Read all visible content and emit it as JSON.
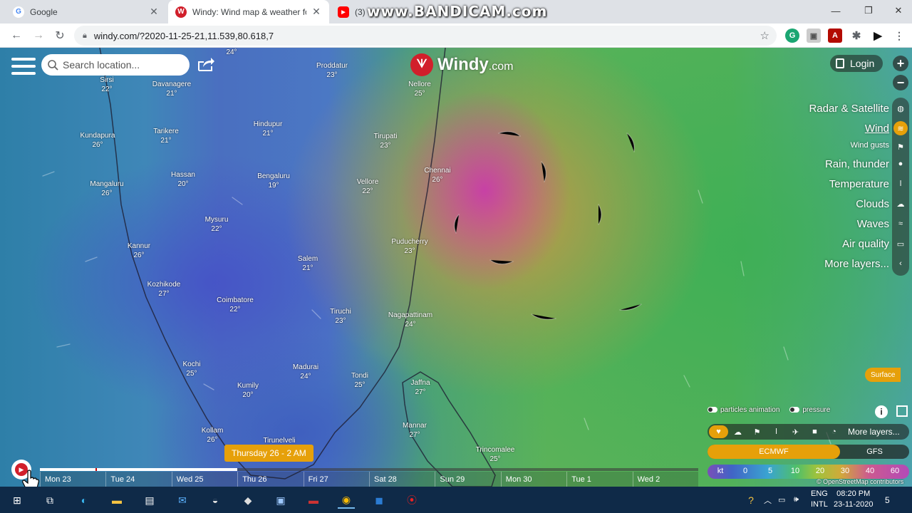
{
  "browser": {
    "tabs": [
      {
        "title": "Google",
        "favicon": "G",
        "color": "#4285f4"
      },
      {
        "title": "Windy: Wind map & weather fore",
        "favicon": "W",
        "color": "#d11f2b"
      },
      {
        "title": "(3) Yo",
        "favicon": "▶",
        "color": "#ff0000"
      }
    ],
    "url": "windy.com/?2020-11-25-21,11.539,80.618,7",
    "watermark": "www.BANDICAM.com"
  },
  "map": {
    "search_placeholder": "Search location...",
    "logo_text": "Windy",
    "logo_domain": ".com",
    "login_label": "Login",
    "cities": [
      {
        "name": "",
        "temp": "24°"
      },
      {
        "name": "Sirsi",
        "temp": "22°"
      },
      {
        "name": "Davanagere",
        "temp": "21°"
      },
      {
        "name": "Proddatur",
        "temp": "23°"
      },
      {
        "name": "Nellore",
        "temp": "25°"
      },
      {
        "name": "Kundapura",
        "temp": "26°"
      },
      {
        "name": "Tarikere",
        "temp": "21°"
      },
      {
        "name": "Hindupur",
        "temp": "21°"
      },
      {
        "name": "Tirupati",
        "temp": "23°"
      },
      {
        "name": "Chennai",
        "temp": "26°"
      },
      {
        "name": "Hassan",
        "temp": "20°"
      },
      {
        "name": "Bengaluru",
        "temp": "19°"
      },
      {
        "name": "Vellore",
        "temp": "22°"
      },
      {
        "name": "Mangaluru",
        "temp": "26°"
      },
      {
        "name": "Mysuru",
        "temp": "22°"
      },
      {
        "name": "Kannur",
        "temp": "26°"
      },
      {
        "name": "Puducherry",
        "temp": "23°"
      },
      {
        "name": "Salem",
        "temp": "21°"
      },
      {
        "name": "Kozhikode",
        "temp": "27°"
      },
      {
        "name": "Coimbatore",
        "temp": "22°"
      },
      {
        "name": "Tiruchi",
        "temp": "23°"
      },
      {
        "name": "Nagapattinam",
        "temp": "24°"
      },
      {
        "name": "Kochi",
        "temp": "25°"
      },
      {
        "name": "Madurai",
        "temp": "24°"
      },
      {
        "name": "Tondi",
        "temp": "25°"
      },
      {
        "name": "Kumily",
        "temp": "20°"
      },
      {
        "name": "Jaffna",
        "temp": "27°"
      },
      {
        "name": "Mannar",
        "temp": "27°"
      },
      {
        "name": "Kollam",
        "temp": "26°"
      },
      {
        "name": "Tirunelveli",
        "temp": ""
      },
      {
        "name": "Trincomalee",
        "temp": "25°"
      }
    ],
    "layers": [
      {
        "label": "Radar & Satellite",
        "icon": "globe-icon"
      },
      {
        "label": "Wind",
        "icon": "wind-icon",
        "active": true
      },
      {
        "label": "Wind gusts",
        "icon": "flag-icon"
      },
      {
        "label": "Rain, thunder",
        "icon": "drop-icon"
      },
      {
        "label": "Temperature",
        "icon": "thermometer-icon"
      },
      {
        "label": "Clouds",
        "icon": "cloud-icon"
      },
      {
        "label": "Waves",
        "icon": "waves-icon"
      },
      {
        "label": "Air quality",
        "icon": "car-icon"
      },
      {
        "label": "More layers...",
        "icon": "chevron-left-icon"
      }
    ],
    "surface_label": "Surface",
    "particles_label": "particles animation",
    "pressure_label": "pressure",
    "overlay_more": "More layers...",
    "models": {
      "active": "ECMWF",
      "other": "GFS"
    },
    "legend": {
      "unit": "kt",
      "ticks": [
        "0",
        "5",
        "10",
        "20",
        "30",
        "40",
        "60"
      ]
    },
    "attribution": "© OpenStreetMap contributors",
    "timeline": {
      "current": "Thursday 26 - 2 AM",
      "progress": 0.3,
      "days": [
        "Mon 23",
        "Tue 24",
        "Wed 25",
        "Thu 26",
        "Fri 27",
        "Sat 28",
        "Sun 29",
        "Mon 30",
        "Tue 1",
        "Wed 2"
      ]
    }
  },
  "taskbar": {
    "lang": "ENG",
    "layout": "INTL",
    "time": "08:20 PM",
    "date": "23-11-2020",
    "notifications": "5"
  },
  "colors": {
    "accent": "#e6a00a",
    "brand": "#d11f2b"
  }
}
